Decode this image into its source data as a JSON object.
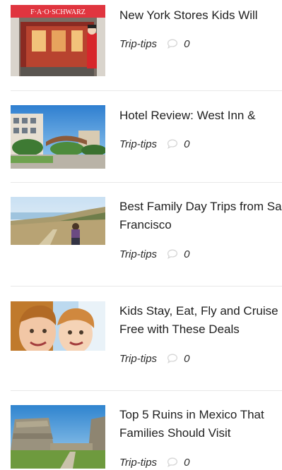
{
  "posts": [
    {
      "title": "New York Stores Kids Will",
      "category": "Trip-tips",
      "comments": "0",
      "image_sign": "F·A·O·SCHWARZ"
    },
    {
      "title": "Hotel Review: West Inn &",
      "category": "Trip-tips",
      "comments": "0"
    },
    {
      "title": "Best Family Day Trips from San Francisco",
      "category": "Trip-tips",
      "comments": "0"
    },
    {
      "title": "Kids Stay, Eat, Fly and Cruise Free with These Deals",
      "category": "Trip-tips",
      "comments": "0"
    },
    {
      "title": "Top 5 Ruins in Mexico That Families Should Visit",
      "category": "Trip-tips",
      "comments": "0"
    }
  ],
  "colors": {
    "title": "#1f1f1f",
    "meta": "#2a2a2a",
    "comment_icon": "#d6d6d6",
    "divider": "#e8e8e8"
  },
  "icons": {
    "comment": "speech-bubble-icon"
  }
}
